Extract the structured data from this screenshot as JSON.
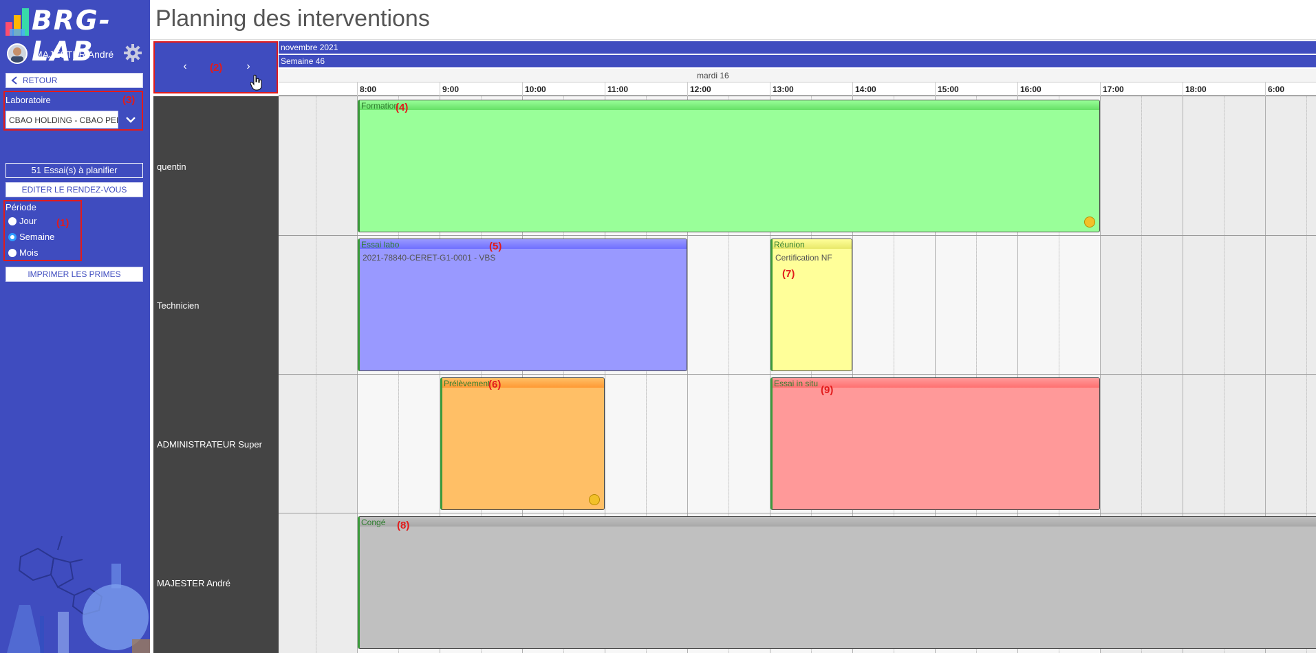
{
  "app": {
    "logo_text": "BRG-LAB"
  },
  "page": {
    "title": "Planning des interventions"
  },
  "user": {
    "name": "MAJESTER André"
  },
  "sidebar": {
    "back_label": "RETOUR",
    "lab_label": "Laboratoire",
    "lab_value": "CBAO HOLDING - CBAO PERPIGNAN",
    "essais_button": "51 Essai(s) à planifier",
    "edit_button": "EDITER LE RENDEZ-VOUS",
    "period_label": "Période",
    "period_options": [
      {
        "label": "Jour",
        "selected": false
      },
      {
        "label": "Semaine",
        "selected": true
      },
      {
        "label": "Mois",
        "selected": false
      }
    ],
    "print_button": "IMPRIMER LES PRIMES"
  },
  "nav": {
    "prev": "‹",
    "next": "›"
  },
  "calendar": {
    "month_label": "novembre 2021",
    "week_label": "Semaine 46",
    "day_label": "mardi 16",
    "hours": [
      "8:00",
      "9:00",
      "10:00",
      "11:00",
      "12:00",
      "13:00",
      "14:00",
      "15:00",
      "16:00",
      "17:00",
      "18:00",
      "6:00"
    ],
    "resources": [
      "quentin",
      "Technicien",
      "ADMINISTRATEUR Super",
      "MAJESTER André"
    ],
    "events": [
      {
        "title": "Formation",
        "subtitle": "",
        "resource": "quentin",
        "color": "#99ff99",
        "bar_color": "#66e066",
        "coin": true
      },
      {
        "title": "Essai labo",
        "subtitle": "2021-78840-CERET-G1-0001 - VBS",
        "resource": "Technicien",
        "color": "#9999ff",
        "bar_color": "#6f6fff",
        "coin": false
      },
      {
        "title": "Réunion",
        "subtitle": "Certification NF",
        "resource": "Technicien",
        "color": "#ffff99",
        "bar_color": "#e8e86a",
        "coin": false
      },
      {
        "title": "Prélèvement",
        "subtitle": "",
        "resource": "ADMINISTRATEUR Super",
        "color": "#ffbf66",
        "bar_color": "#ff9933",
        "coin": true
      },
      {
        "title": "Essai in situ",
        "subtitle": "",
        "resource": "ADMINISTRATEUR Super",
        "color": "#ff9999",
        "bar_color": "#ff7070",
        "coin": false
      },
      {
        "title": "Congé",
        "subtitle": "",
        "resource": "MAJESTER André",
        "color": "#c0c0c0",
        "bar_color": "#a8a8a8",
        "coin": false
      }
    ]
  },
  "annotations": [
    "(1)",
    "(2)",
    "(3)",
    "(4)",
    "(5)",
    "(6)",
    "(7)",
    "(8)",
    "(9)"
  ]
}
